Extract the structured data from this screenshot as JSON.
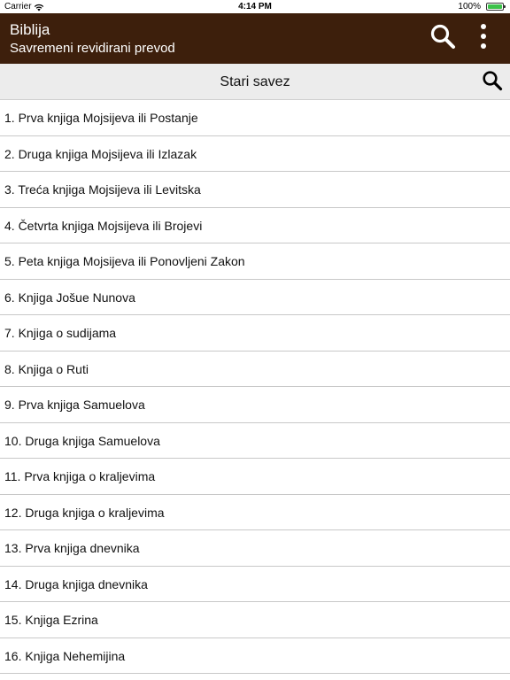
{
  "status_bar": {
    "carrier": "Carrier",
    "time": "4:14 PM",
    "battery": "100%",
    "battery_color": "#3cc24a"
  },
  "app_bar": {
    "title": "Biblija",
    "subtitle": "Savremeni revidirani prevod",
    "background": "#3d1f0c",
    "icons": [
      "search-icon",
      "more-vertical-icon"
    ]
  },
  "section": {
    "heading": "Stari savez",
    "icon": "search-icon"
  },
  "books": [
    "1. Prva knjiga Mojsijeva ili Postanje",
    "2. Druga knjiga Mojsijeva ili Izlazak",
    "3. Treća knjiga Mojsijeva ili Levitska",
    "4. Četvrta knjiga Mojsijeva ili Brojevi",
    "5. Peta knjiga Mojsijeva ili Ponovljeni Zakon",
    "6. Knjiga Jošue Nunova",
    "7. Knjiga o sudijama",
    "8. Knjiga o Ruti",
    "9. Prva knjiga Samuelova",
    "10. Druga knjiga Samuelova",
    "11. Prva knjiga o kraljevima",
    "12. Druga knjiga o kraljevima",
    "13. Prva knjiga dnevnika",
    "14. Druga knjiga dnevnika",
    "15. Knjiga Ezrina",
    "16. Knjiga Nehemijina"
  ]
}
